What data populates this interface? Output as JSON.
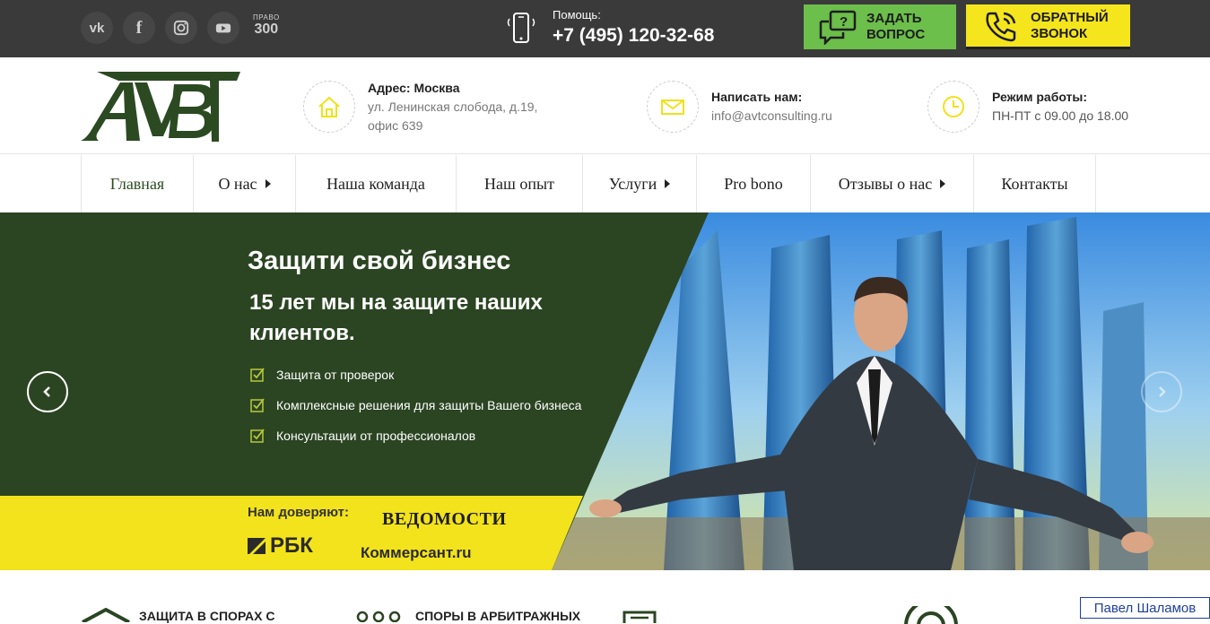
{
  "topbar": {
    "social": [
      {
        "name": "vk",
        "label": "vk"
      },
      {
        "name": "facebook",
        "label": "f"
      },
      {
        "name": "instagram",
        "label": ""
      },
      {
        "name": "youtube",
        "label": ""
      }
    ],
    "pravo_top": "ПРАВО",
    "pravo_num": "300",
    "help_label": "Помощь:",
    "help_phone": "+7 (495) 120-32-68",
    "ask_line1": "ЗАДАТЬ",
    "ask_line2": "ВОПРОС",
    "call_line1": "ОБРАТНЫЙ",
    "call_line2": "ЗВОНОК",
    "ask_color": "#6cbf4a",
    "call_color": "#f5e51d"
  },
  "header": {
    "address_title": "Адрес: Москва",
    "address_line1": "ул. Ленинская слобода, д.19,",
    "address_line2": "офис 639",
    "email_title": "Написать нам:",
    "email_value": "info@avtconsulting.ru",
    "hours_title": "Режим работы:",
    "hours_value": "ПН-ПТ с 09.00 до 18.00",
    "icon_color": "#f0e21a"
  },
  "nav": {
    "items": [
      {
        "label": "Главная"
      },
      {
        "label": "О нас"
      },
      {
        "label": "Наша команда"
      },
      {
        "label": "Наш опыт"
      },
      {
        "label": "Услуги"
      },
      {
        "label": "Pro bono"
      },
      {
        "label": "Отзывы о нас"
      },
      {
        "label": "Контакты"
      }
    ]
  },
  "hero": {
    "title": "Защити свой бизнес",
    "subtitle": "15 лет мы на защите наших клиентов.",
    "features": [
      "Защита от проверок",
      "Комплексные решения для защиты Вашего бизнеса",
      "Консультации от профессионалов"
    ],
    "trust_label": "Нам доверяют:",
    "logo_vedomosti": "ВЕДОМОСТИ",
    "logo_rbk": "РБК",
    "logo_kommersant": "Коммерсант.ru",
    "green": "#2b4522",
    "yellow": "#f3e31c"
  },
  "bottom": {
    "service1": "ЗАЩИТА В СПОРАХ С",
    "service2": "СПОРЫ В АРБИТРАЖНЫХ"
  },
  "tooltip": "Павел Шаламов"
}
